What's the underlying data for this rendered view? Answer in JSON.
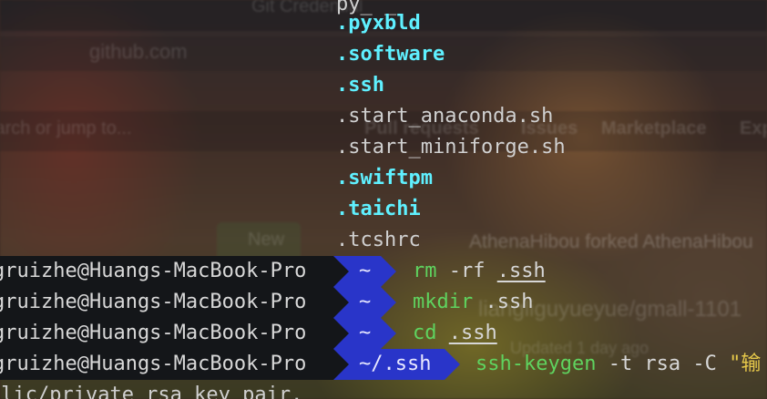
{
  "background_browser": {
    "tab_title": "Git Credential",
    "url": "github.com",
    "search_hint": "Search or jump to...",
    "nav_items": [
      "Pull requests",
      "Issues",
      "Marketplace",
      "Explore"
    ],
    "new_button": "New",
    "feed_line_1": "AthenaHibou forked AthenaHibou",
    "feed_line_2": "liangliguyueyue/gmall-1101",
    "feed_line_3": "Updated 1 day ago"
  },
  "terminal": {
    "partial_top": "py_ _ ",
    "ls_entries": [
      {
        "name": ".pyxbld",
        "kind": "dir"
      },
      {
        "name": ".software",
        "kind": "dir"
      },
      {
        "name": ".ssh",
        "kind": "dir"
      },
      {
        "name": ".start_anaconda.sh",
        "kind": "file"
      },
      {
        "name": ".start_miniforge.sh",
        "kind": "file"
      },
      {
        "name": ".swiftpm",
        "kind": "dir"
      },
      {
        "name": ".taichi",
        "kind": "dir"
      },
      {
        "name": ".tcshrc",
        "kind": "file"
      }
    ],
    "prompts": [
      {
        "user": "gruizhe@Huangs-MacBook-Pro",
        "dir": "~",
        "cmd": "rm",
        "args": " -rf ",
        "path": ".ssh",
        "tail": ""
      },
      {
        "user": "gruizhe@Huangs-MacBook-Pro",
        "dir": "~",
        "cmd": "mkdir",
        "args": " .ssh",
        "path": "",
        "tail": ""
      },
      {
        "user": "gruizhe@Huangs-MacBook-Pro",
        "dir": "~",
        "cmd": "cd",
        "args": " ",
        "path": ".ssh",
        "tail": ""
      },
      {
        "user": "gruizhe@Huangs-MacBook-Pro",
        "dir": "~/.ssh",
        "cmd": "ssh-keygen",
        "args": " -t rsa -C ",
        "path": "",
        "tail": "\"输"
      }
    ],
    "output_last": "blic/private rsa key pair."
  },
  "colors": {
    "dir_color": "#5ff0ff",
    "prompt_bg_user": "#141619",
    "prompt_bg_dir": "#2935c9",
    "command_green": "#5fd35f"
  }
}
